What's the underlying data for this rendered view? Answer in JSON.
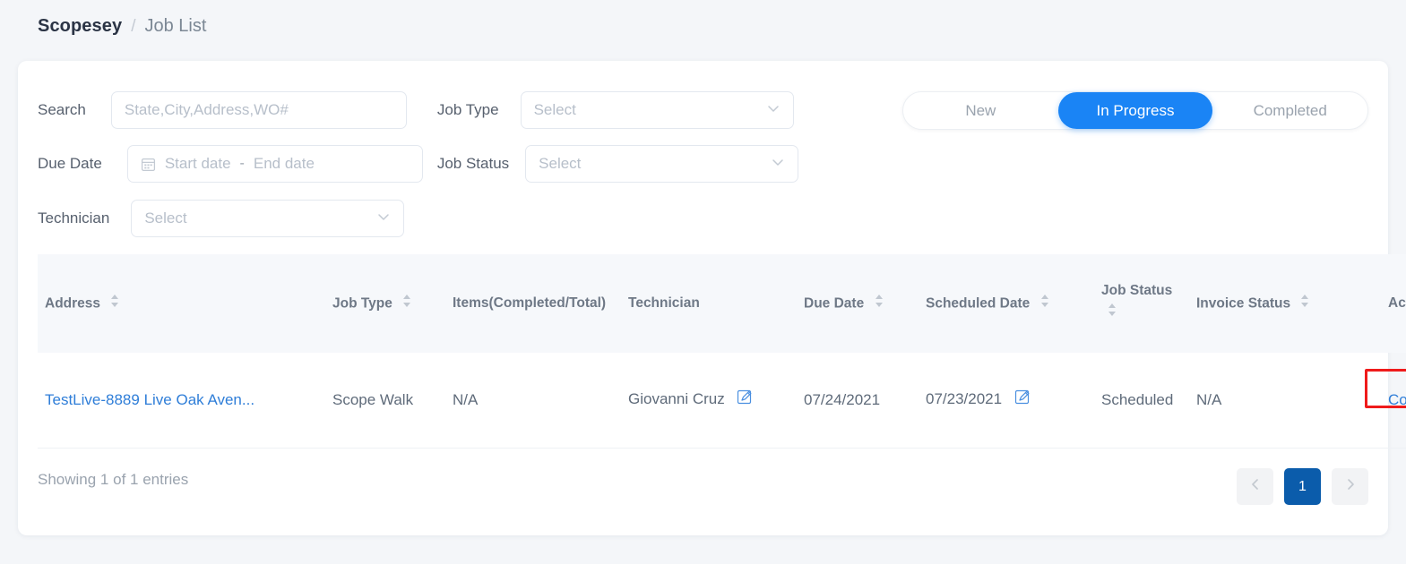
{
  "breadcrumb": {
    "root": "Scopesey",
    "separator": "/",
    "current": "Job List"
  },
  "filters": {
    "search_label": "Search",
    "search_placeholder": "State,City,Address,WO#",
    "search_value": "",
    "job_type_label": "Job Type",
    "job_type_placeholder": "Select",
    "job_type_value": "",
    "due_date_label": "Due Date",
    "start_date_placeholder": "Start date",
    "end_date_placeholder": "End date",
    "date_separator": "-",
    "job_status_label": "Job Status",
    "job_status_placeholder": "Select",
    "job_status_value": "",
    "technician_label": "Technician",
    "technician_placeholder": "Select",
    "technician_value": "",
    "calendar_icon": "calendar-icon",
    "chevron_icon": "chevron-down-icon"
  },
  "segmented": {
    "options": [
      {
        "label": "New",
        "active": false
      },
      {
        "label": "In Progress",
        "active": true
      },
      {
        "label": "Completed",
        "active": false
      }
    ],
    "active_color": "#1a84f5"
  },
  "table": {
    "columns": [
      {
        "label": "Address",
        "sortable": true
      },
      {
        "label": "Job Type",
        "sortable": true
      },
      {
        "label": "Items(Completed/Total)",
        "sortable": false
      },
      {
        "label": "Technician",
        "sortable": false
      },
      {
        "label": "Due Date",
        "sortable": true
      },
      {
        "label": "Scheduled Date",
        "sortable": true
      },
      {
        "label": "Job Status",
        "sortable": true
      },
      {
        "label": "Invoice Status",
        "sortable": true
      },
      {
        "label": "Action",
        "sortable": false
      }
    ],
    "rows": [
      {
        "address": "TestLive-8889 Live Oak Aven...",
        "job_type": "Scope Walk",
        "items": "N/A",
        "technician": "Giovanni Cruz",
        "technician_edit_icon": "edit-pencil-icon",
        "due_date": "07/24/2021",
        "scheduled_date": "07/23/2021",
        "scheduled_edit_icon": "edit-pencil-icon",
        "job_status": "Scheduled",
        "invoice_status": "N/A",
        "action": "Continue"
      }
    ]
  },
  "footer": {
    "entries_text": "Showing 1 of 1 entries",
    "pagination": {
      "prev_icon": "chevron-left-icon",
      "next_icon": "chevron-right-icon",
      "pages": [
        "1"
      ],
      "current_page": "1"
    }
  },
  "annotation": {
    "target": "Continue",
    "color": "#ef1b1b"
  },
  "colors": {
    "link": "#2f7ed8",
    "accent": "#1a84f5",
    "page_bg": "#f4f6f9",
    "card_bg": "#ffffff",
    "header_bg": "#f6f8fb",
    "pager_active": "#0b5cab"
  }
}
